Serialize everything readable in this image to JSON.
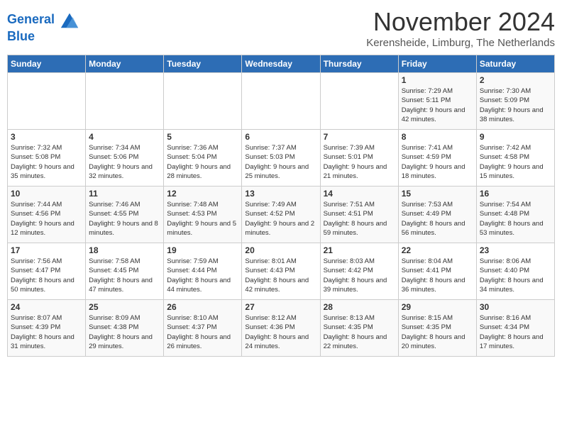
{
  "logo": {
    "line1": "General",
    "line2": "Blue"
  },
  "title": "November 2024",
  "subtitle": "Kerensheide, Limburg, The Netherlands",
  "days_of_week": [
    "Sunday",
    "Monday",
    "Tuesday",
    "Wednesday",
    "Thursday",
    "Friday",
    "Saturday"
  ],
  "weeks": [
    [
      {
        "day": "",
        "info": ""
      },
      {
        "day": "",
        "info": ""
      },
      {
        "day": "",
        "info": ""
      },
      {
        "day": "",
        "info": ""
      },
      {
        "day": "",
        "info": ""
      },
      {
        "day": "1",
        "info": "Sunrise: 7:29 AM\nSunset: 5:11 PM\nDaylight: 9 hours and 42 minutes."
      },
      {
        "day": "2",
        "info": "Sunrise: 7:30 AM\nSunset: 5:09 PM\nDaylight: 9 hours and 38 minutes."
      }
    ],
    [
      {
        "day": "3",
        "info": "Sunrise: 7:32 AM\nSunset: 5:08 PM\nDaylight: 9 hours and 35 minutes."
      },
      {
        "day": "4",
        "info": "Sunrise: 7:34 AM\nSunset: 5:06 PM\nDaylight: 9 hours and 32 minutes."
      },
      {
        "day": "5",
        "info": "Sunrise: 7:36 AM\nSunset: 5:04 PM\nDaylight: 9 hours and 28 minutes."
      },
      {
        "day": "6",
        "info": "Sunrise: 7:37 AM\nSunset: 5:03 PM\nDaylight: 9 hours and 25 minutes."
      },
      {
        "day": "7",
        "info": "Sunrise: 7:39 AM\nSunset: 5:01 PM\nDaylight: 9 hours and 21 minutes."
      },
      {
        "day": "8",
        "info": "Sunrise: 7:41 AM\nSunset: 4:59 PM\nDaylight: 9 hours and 18 minutes."
      },
      {
        "day": "9",
        "info": "Sunrise: 7:42 AM\nSunset: 4:58 PM\nDaylight: 9 hours and 15 minutes."
      }
    ],
    [
      {
        "day": "10",
        "info": "Sunrise: 7:44 AM\nSunset: 4:56 PM\nDaylight: 9 hours and 12 minutes."
      },
      {
        "day": "11",
        "info": "Sunrise: 7:46 AM\nSunset: 4:55 PM\nDaylight: 9 hours and 8 minutes."
      },
      {
        "day": "12",
        "info": "Sunrise: 7:48 AM\nSunset: 4:53 PM\nDaylight: 9 hours and 5 minutes."
      },
      {
        "day": "13",
        "info": "Sunrise: 7:49 AM\nSunset: 4:52 PM\nDaylight: 9 hours and 2 minutes."
      },
      {
        "day": "14",
        "info": "Sunrise: 7:51 AM\nSunset: 4:51 PM\nDaylight: 8 hours and 59 minutes."
      },
      {
        "day": "15",
        "info": "Sunrise: 7:53 AM\nSunset: 4:49 PM\nDaylight: 8 hours and 56 minutes."
      },
      {
        "day": "16",
        "info": "Sunrise: 7:54 AM\nSunset: 4:48 PM\nDaylight: 8 hours and 53 minutes."
      }
    ],
    [
      {
        "day": "17",
        "info": "Sunrise: 7:56 AM\nSunset: 4:47 PM\nDaylight: 8 hours and 50 minutes."
      },
      {
        "day": "18",
        "info": "Sunrise: 7:58 AM\nSunset: 4:45 PM\nDaylight: 8 hours and 47 minutes."
      },
      {
        "day": "19",
        "info": "Sunrise: 7:59 AM\nSunset: 4:44 PM\nDaylight: 8 hours and 44 minutes."
      },
      {
        "day": "20",
        "info": "Sunrise: 8:01 AM\nSunset: 4:43 PM\nDaylight: 8 hours and 42 minutes."
      },
      {
        "day": "21",
        "info": "Sunrise: 8:03 AM\nSunset: 4:42 PM\nDaylight: 8 hours and 39 minutes."
      },
      {
        "day": "22",
        "info": "Sunrise: 8:04 AM\nSunset: 4:41 PM\nDaylight: 8 hours and 36 minutes."
      },
      {
        "day": "23",
        "info": "Sunrise: 8:06 AM\nSunset: 4:40 PM\nDaylight: 8 hours and 34 minutes."
      }
    ],
    [
      {
        "day": "24",
        "info": "Sunrise: 8:07 AM\nSunset: 4:39 PM\nDaylight: 8 hours and 31 minutes."
      },
      {
        "day": "25",
        "info": "Sunrise: 8:09 AM\nSunset: 4:38 PM\nDaylight: 8 hours and 29 minutes."
      },
      {
        "day": "26",
        "info": "Sunrise: 8:10 AM\nSunset: 4:37 PM\nDaylight: 8 hours and 26 minutes."
      },
      {
        "day": "27",
        "info": "Sunrise: 8:12 AM\nSunset: 4:36 PM\nDaylight: 8 hours and 24 minutes."
      },
      {
        "day": "28",
        "info": "Sunrise: 8:13 AM\nSunset: 4:35 PM\nDaylight: 8 hours and 22 minutes."
      },
      {
        "day": "29",
        "info": "Sunrise: 8:15 AM\nSunset: 4:35 PM\nDaylight: 8 hours and 20 minutes."
      },
      {
        "day": "30",
        "info": "Sunrise: 8:16 AM\nSunset: 4:34 PM\nDaylight: 8 hours and 17 minutes."
      }
    ]
  ]
}
